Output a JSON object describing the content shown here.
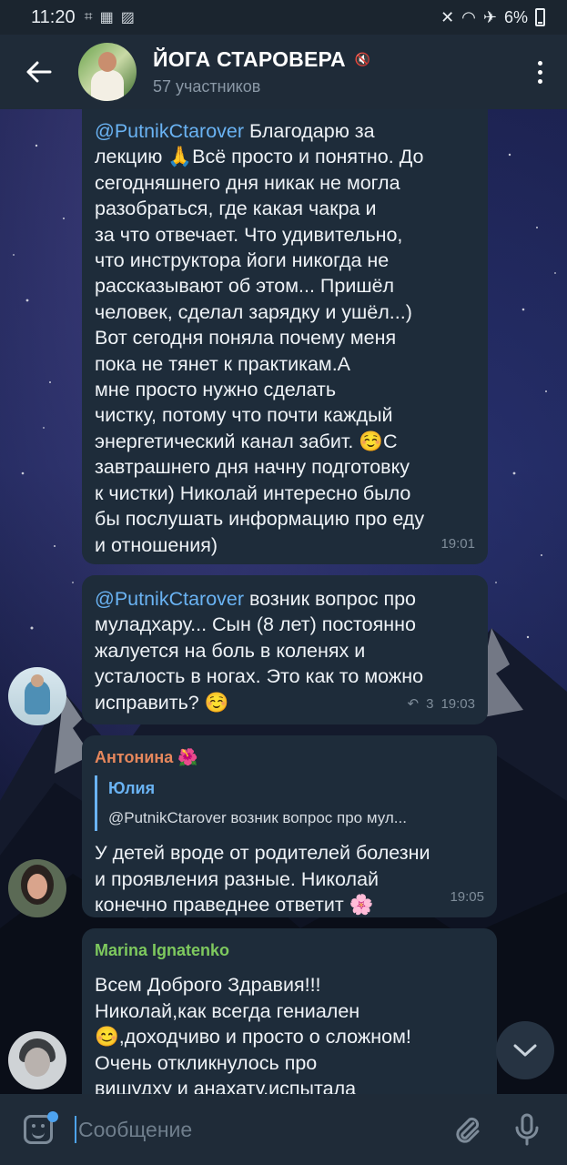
{
  "status_bar": {
    "time": "11:20",
    "battery": "6%",
    "icons_left": [
      "grid-icon",
      "gallery-icon",
      "image-icon"
    ],
    "icons_right": [
      "mute-icon",
      "wifi-icon",
      "airplane-icon",
      "battery-icon"
    ]
  },
  "header": {
    "title": "ЙОГА СТАРОВЕРА",
    "subtitle": "57 участников",
    "back_icon": "arrow-left-icon",
    "menu_icon": "more-vertical-icon"
  },
  "messages": [
    {
      "mention": "@PutnikCtarover",
      "text": " Благодарю за\nлекцию 🙏Всё просто и понятно. До\nсегодняшнего дня  никак не могла\nразобраться, где какая чакра и\nза что отвечает. Что удивительно,\nчто инструктора йоги никогда не\nрассказывают об этом... Пришёл\nчеловек, сделал зарядку и  ушёл...)\nВот сегодня поняла почему меня\nпока не тянет к практикам.А\nмне просто нужно сделать\nчистку, потому что почти каждый\nэнергетический канал забит. ☺️С\nзавтрашнего дня начну подготовку\nк чистки)  Николай интересно было\nбы послушать информацию про еду\nи отношения)",
      "time": "19:01"
    },
    {
      "mention": "@PutnikCtarover",
      "text": " возник вопрос про\nмуладхару... Сын (8 лет) постоянно\nжалуется на боль в  коленях и\nусталость в ногах. Это как то можно\nисправить? ☺️",
      "replies_count": "3",
      "time": "19:03"
    },
    {
      "sender": "Антонина 🌺",
      "sender_color": "#e6875c",
      "reply_to": {
        "name": "Юлия",
        "text": "@PutnikCtarover возник вопрос про мул..."
      },
      "text": "У детей вроде от родителей болезни\nи проявления разные. Николай\nконечно праведнее ответит 🌸",
      "time": "19:05"
    },
    {
      "sender": "Marina Ignatenko",
      "sender_color": "#7ec95e",
      "text": "Всем Доброго Здравия!!!\nНиколай,как всегда гениален\n😊,доходчиво и просто о сложном!\nОчень откликнулось про\nвишудху и анахату,испытала"
    }
  ],
  "input": {
    "placeholder": "Сообщение",
    "value": ""
  },
  "colors": {
    "accent": "#4da3f0",
    "link": "#6ab3f3",
    "bubble": "#1e2c3a",
    "header": "#1f2b38"
  }
}
